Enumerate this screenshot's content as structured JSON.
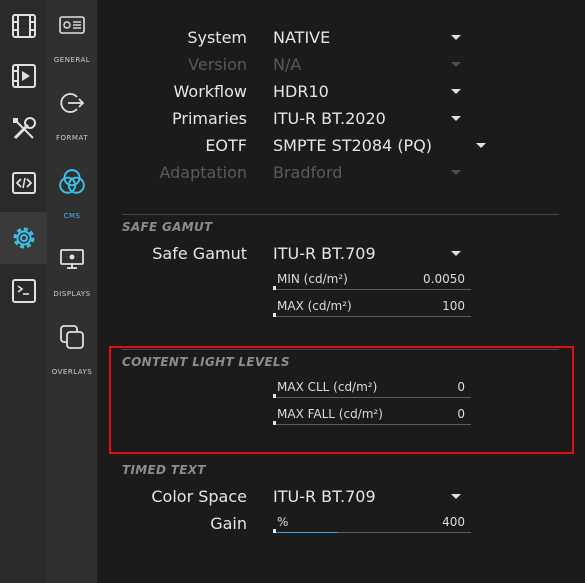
{
  "rail": {
    "items": [
      {
        "icon": "film-icon"
      },
      {
        "icon": "video-clip-icon"
      },
      {
        "icon": "tools-icon"
      },
      {
        "icon": "code-icon"
      },
      {
        "icon": "settings-icon",
        "active": true
      },
      {
        "icon": "terminal-icon"
      }
    ]
  },
  "side": {
    "items": [
      {
        "label": "GENERAL",
        "icon": "general-icon"
      },
      {
        "label": "FORMAT",
        "icon": "format-icon"
      },
      {
        "label": "CMS",
        "icon": "cms-icon",
        "active": true
      },
      {
        "label": "DISPLAYS",
        "icon": "displays-icon"
      },
      {
        "label": "OVERLAYS",
        "icon": "overlays-icon"
      }
    ]
  },
  "settings": {
    "system": {
      "label": "System",
      "value": "NATIVE"
    },
    "version": {
      "label": "Version",
      "value": "N/A",
      "disabled": true
    },
    "workflow": {
      "label": "Workflow",
      "value": "HDR10"
    },
    "primaries": {
      "label": "Primaries",
      "value": "ITU-R BT.2020"
    },
    "eotf": {
      "label": "EOTF",
      "value": "SMPTE ST2084 (PQ)"
    },
    "adaptation": {
      "label": "Adaptation",
      "value": "Bradford",
      "disabled": true
    }
  },
  "safe_gamut": {
    "title": "SAFE GAMUT",
    "gamut": {
      "label": "Safe Gamut",
      "value": "ITU-R BT.709"
    },
    "min": {
      "label": "MIN (cd/m²)",
      "value": "0.0050"
    },
    "max": {
      "label": "MAX (cd/m²)",
      "value": "100"
    }
  },
  "content_light": {
    "title": "CONTENT LIGHT LEVELS",
    "max_cll": {
      "label": "MAX CLL (cd/m²)",
      "value": "0"
    },
    "max_fall": {
      "label": "MAX FALL (cd/m²)",
      "value": "0"
    }
  },
  "timed_text": {
    "title": "TIMED TEXT",
    "color_space": {
      "label": "Color Space",
      "value": "ITU-R BT.709"
    },
    "gain": {
      "label": "Gain",
      "unit": "%",
      "value": "400",
      "fill_fraction": 0.33
    }
  },
  "colors": {
    "accent": "#3cc0e8",
    "highlight": "#e01010"
  }
}
